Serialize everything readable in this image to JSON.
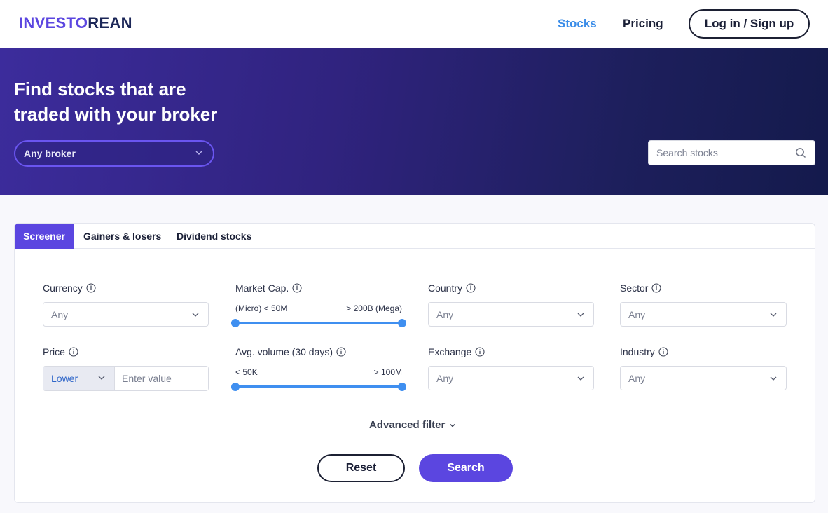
{
  "header": {
    "logo_part1": "INVESTO",
    "logo_part2": "REAN",
    "nav": {
      "stocks": "Stocks",
      "pricing": "Pricing"
    },
    "login_label": "Log in / Sign up"
  },
  "hero": {
    "title_line1": "Find stocks that are",
    "title_line2": "traded with your broker",
    "broker_select": "Any broker",
    "search_placeholder": "Search stocks"
  },
  "tabs": {
    "screener": "Screener",
    "gainers": "Gainers & losers",
    "dividend": "Dividend stocks",
    "active": "Screener"
  },
  "filters": {
    "currency": {
      "label": "Currency",
      "value": "Any"
    },
    "market_cap": {
      "label": "Market Cap.",
      "min_label": "(Micro) < 50M",
      "max_label": "> 200B (Mega)",
      "range": [
        0,
        1
      ]
    },
    "country": {
      "label": "Country",
      "value": "Any"
    },
    "sector": {
      "label": "Sector",
      "value": "Any"
    },
    "price": {
      "label": "Price",
      "operator": "Lower",
      "placeholder": "Enter value"
    },
    "avg_volume": {
      "label": "Avg. volume (30 days)",
      "min_label": "< 50K",
      "max_label": "> 100M",
      "range": [
        0,
        1
      ]
    },
    "exchange": {
      "label": "Exchange",
      "value": "Any"
    },
    "industry": {
      "label": "Industry",
      "value": "Any"
    }
  },
  "advanced_filter_label": "Advanced filter",
  "actions": {
    "reset": "Reset",
    "search": "Search"
  },
  "colors": {
    "accent": "#5b46e0",
    "link": "#3b8de8",
    "slider": "#3f8ff0"
  },
  "icons": {
    "info": "info-icon",
    "chevron": "chevron-down-icon",
    "search": "search-icon"
  }
}
